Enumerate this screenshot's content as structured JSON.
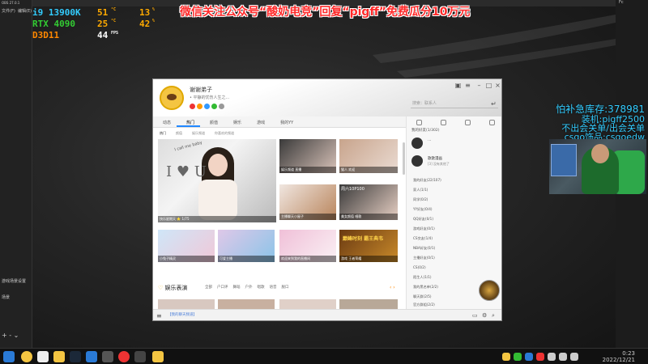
{
  "overlay": {
    "cpu_name": "i9 13900K",
    "cpu_temp": "51",
    "cpu_temp_unit": "°C",
    "cpu_load": "13",
    "cpu_load_unit": "%",
    "gpu_name": "RTX 4090",
    "gpu_temp": "25",
    "gpu_temp_unit": "°C",
    "gpu_load": "42",
    "gpu_load_unit": "%",
    "api": "D3D11",
    "fps": "44",
    "fps_unit": "FPS"
  },
  "promo_banner": "微信关注公众号“酸奶电竞”回复“pigff”免费瓜分10万元",
  "side_overlay": {
    "inventory": "怕补急库存:378981",
    "line2": "装机:pigff2500",
    "line3": "不出会关单/出会关单",
    "line4": "csgo饰品:csgoedw"
  },
  "obs": {
    "title": "OBS 27.0.1",
    "menu": [
      "文件(F)",
      "编辑(E)"
    ],
    "scene_label": "游戏场景设置",
    "source_label": "场景",
    "controls": "+ - ⌄"
  },
  "qq": {
    "nickname": "谢谢弟子",
    "signature": "• 平静的忧伤人生之...",
    "search_placeholder": "搜索：联系人",
    "tabs": [
      "动态",
      "热门",
      "颜值",
      "娱乐",
      "游戏",
      "我的YY"
    ],
    "active_tab": 1,
    "subtabs": [
      "热门",
      "颜值",
      "娱乐频道",
      "你喜欢的频道"
    ],
    "tiles": [
      {
        "cap": "I call me baby",
        "lbl": "快乐星期天  ⭐ 1/75"
      },
      {
        "cap": "",
        "lbl": "娱乐频道  直播"
      },
      {
        "cap": "",
        "lbl": "猫人  欢迎"
      },
      {
        "cap": "",
        "lbl": "主播聊天小屋子"
      },
      {
        "cap": "周六10P100",
        "lbl": "美女颜值  唱歌"
      },
      {
        "cap": "",
        "lbl": "小兔子精灵"
      },
      {
        "cap": "",
        "lbl": "可爱主播"
      },
      {
        "cap": "",
        "lbl": "欢迎来到我的直播间"
      },
      {
        "cap": "巅峰时刻 霸王典韦",
        "lbl": "游戏  王者荣耀"
      }
    ],
    "section_title": "娱乐表演",
    "section_items": [
      "全部",
      "户口评",
      "舞蹈",
      "户外",
      "唱歌",
      "语音",
      "脱口"
    ],
    "bottom_note": "【我的聊天频道】",
    "right_header": "我的好友(1/302)",
    "friends": [
      {
        "name": "…",
        "status": ""
      },
      {
        "name": "歌歌漫画",
        "status": "[3] 没有其他了"
      }
    ],
    "groups": [
      "我的好友(22/107)",
      "家人(1/1)",
      "同学(0/2)",
      "YY好友(0/4)",
      "QQ好友(0/1)",
      "游戏好友(0/1)",
      "CS交友(1/4)",
      "NBA好友(0/1)",
      "主播好友(0/1)",
      "CS(0/2)",
      "陌生人(1/1)",
      "我的黑名单(2/2)",
      "聊天群(2/5)",
      "官方群组(2/2)"
    ]
  },
  "taskbar": {
    "time": "0:23",
    "date": "2022/12/21"
  }
}
